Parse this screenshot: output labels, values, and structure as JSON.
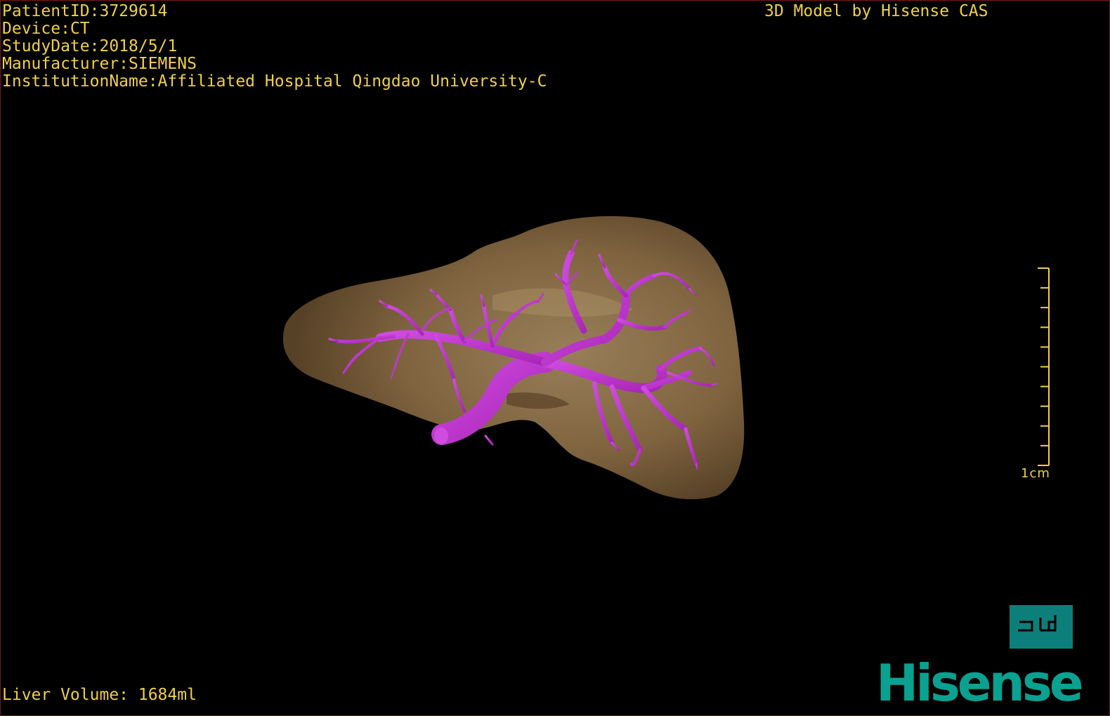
{
  "overlay": {
    "patient_id": "PatientID:3729614",
    "device": "Device:CT",
    "study_date": "StudyDate:2018/5/1",
    "manufacturer": "Manufacturer:SIEMENS",
    "institution": "InstitutionName:Affiliated Hospital Qingdao University-C",
    "credit": "3D Model by Hisense CAS",
    "liver_volume": "Liver Volume: 1684ml"
  },
  "scale": {
    "label": "1cm",
    "tick_count": 11
  },
  "orientation_cube": {
    "face_label": "┘d"
  },
  "logo": {
    "text": "Hisense"
  },
  "colors": {
    "overlay_text": "#f0cf46",
    "liver": "#8b6f48",
    "portal_vein": "#c23ad4",
    "cube": "#0d7f7a",
    "logo": "#0aa190",
    "border": "#7a1a1a"
  },
  "icons": {
    "orientation": "orientation-cube-icon",
    "logo": "hisense-logo"
  }
}
